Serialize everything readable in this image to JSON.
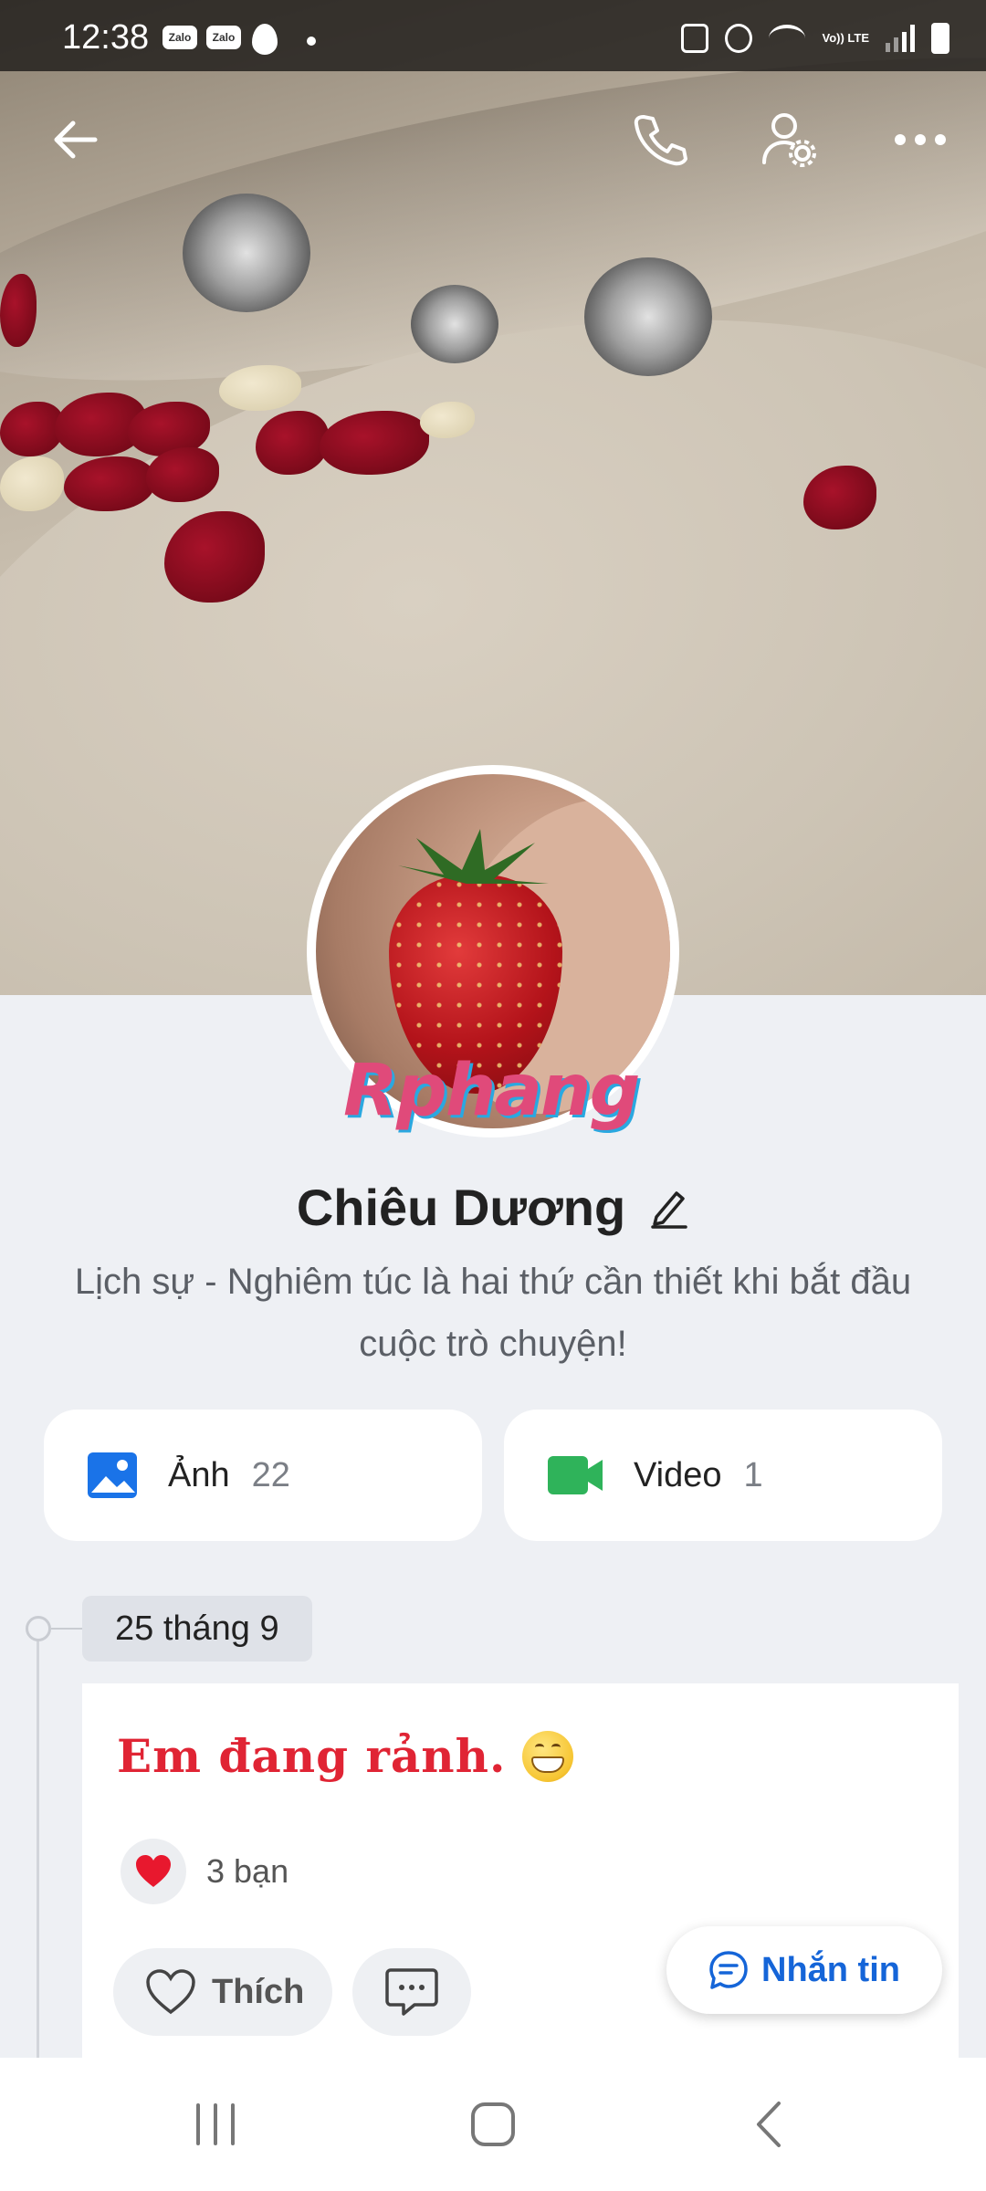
{
  "status_bar": {
    "time": "12:38",
    "app_icons": [
      "Zalo",
      "Zalo"
    ],
    "volte": "Vo)) LTE"
  },
  "profile": {
    "name": "Chiêu Dương",
    "bio": "Lịch sự - Nghiêm túc là hai thứ cần thiết khi bắt đầu cuộc trò chuyện!",
    "watermark": "Rphang"
  },
  "media": {
    "photos": {
      "label": "Ảnh",
      "count": "22",
      "icon": "image-icon",
      "color": "#1a73e8"
    },
    "videos": {
      "label": "Video",
      "count": "1",
      "icon": "video-camera-icon",
      "color": "#2fb35a"
    }
  },
  "timeline": {
    "date": "25 tháng 9",
    "post": {
      "text": "Em đang rảnh.",
      "emoji": "grinning-face",
      "reaction_count": "3 bạn",
      "like_label": "Thích"
    }
  },
  "message_button": {
    "label": "Nhắn tin"
  },
  "colors": {
    "accent": "#1565d8",
    "post_text": "#e02434",
    "page_bg": "#eef0f4"
  }
}
